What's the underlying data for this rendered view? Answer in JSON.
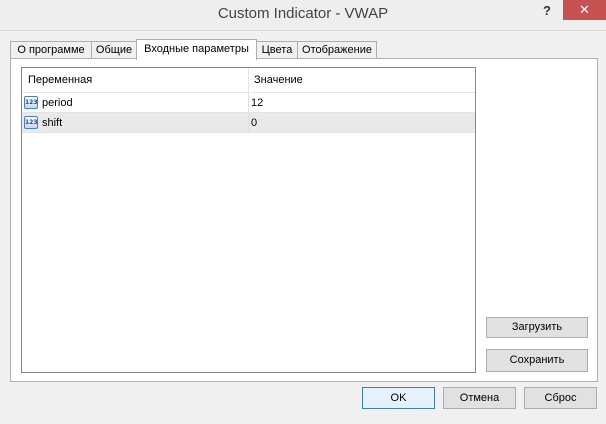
{
  "window": {
    "title": "Custom Indicator - VWAP",
    "help_label": "?",
    "close_label": "✕"
  },
  "tabs": [
    {
      "label": "О программе",
      "active": false
    },
    {
      "label": "Общие",
      "active": false
    },
    {
      "label": "Входные параметры",
      "active": true
    },
    {
      "label": "Цвета",
      "active": false
    },
    {
      "label": "Отображение",
      "active": false
    }
  ],
  "params_table": {
    "columns": [
      "Переменная",
      "Значение"
    ],
    "rows": [
      {
        "icon": "number-123-icon",
        "icon_text": "123",
        "name": "period",
        "value": "12"
      },
      {
        "icon": "number-123-icon",
        "icon_text": "123",
        "name": "shift",
        "value": "0"
      }
    ]
  },
  "side_buttons": {
    "load_label": "Загрузить",
    "save_label": "Сохранить"
  },
  "footer": {
    "ok_label": "OK",
    "cancel_label": "Отмена",
    "reset_label": "Сброс"
  },
  "colors": {
    "close_button": "#c75050",
    "default_button_border": "#3c7fb1",
    "selected_row": "#e9e9e9"
  }
}
